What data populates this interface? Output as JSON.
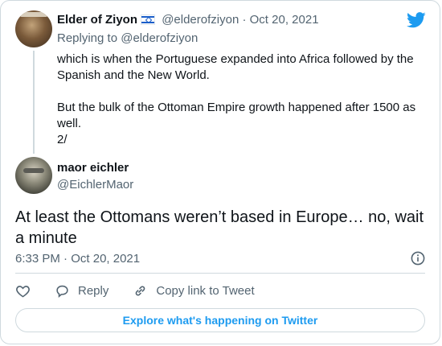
{
  "parent_tweet": {
    "author_name": "Elder of Ziyon",
    "flag_emoji": "israel-flag",
    "handle": "@elderofziyon",
    "separator": "·",
    "date": "Oct 20, 2021",
    "replying_prefix": "Replying to",
    "replying_handle": "@elderofziyon",
    "paragraph1": "which is when the Portuguese expanded into Africa followed by the Spanish and the New World.",
    "paragraph2": "But the bulk of the Ottoman Empire growth happened after 1500 as well.",
    "paragraph3": "2/"
  },
  "main_tweet": {
    "author_name": "maor eichler",
    "handle": "@EichlerMaor",
    "text": "At least the Ottomans weren’t based in Europe… no, wait a minute",
    "time": "6:33 PM",
    "separator": "·",
    "date": "Oct 20, 2021"
  },
  "actions": {
    "reply_label": "Reply",
    "copy_link_label": "Copy link to Tweet"
  },
  "explore_label": "Explore what's happening on Twitter",
  "colors": {
    "twitter_blue": "#1d9bf0",
    "secondary_text": "#536471",
    "border": "#cfd9de"
  }
}
